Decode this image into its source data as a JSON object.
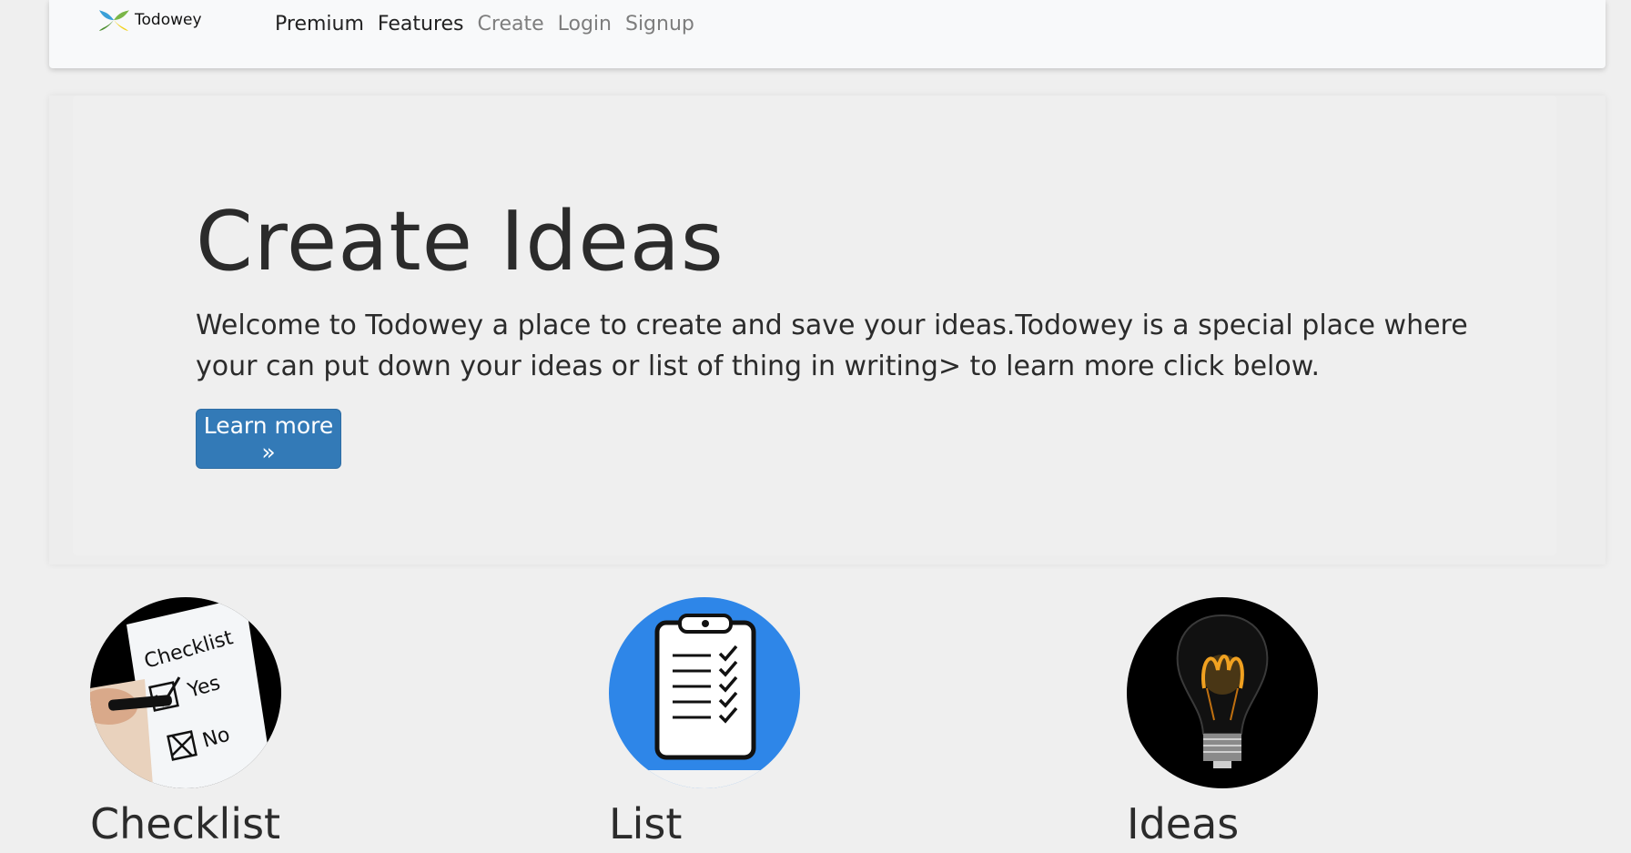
{
  "nav": {
    "brand": "Todowey",
    "links": [
      {
        "label": "Premium",
        "style": "dark"
      },
      {
        "label": "Features",
        "style": "dark"
      },
      {
        "label": "Create",
        "style": "muted"
      },
      {
        "label": "Login",
        "style": "muted"
      },
      {
        "label": "Signup",
        "style": "muted"
      }
    ]
  },
  "hero": {
    "title": "Create Ideas",
    "text": "Welcome to Todowey a place to create and save your ideas.Todowey is a special place where your can put down your ideas or list of thing in writing> to learn more click below.",
    "button_label": "Learn more »"
  },
  "features": [
    {
      "title": "Checklist",
      "image": "checklist-photo"
    },
    {
      "title": "List",
      "image": "clipboard-checklist-icon"
    },
    {
      "title": "Ideas",
      "image": "lightbulb-photo"
    }
  ],
  "colors": {
    "primary_button": "#337ab7",
    "list_icon_bg": "#2e86e8",
    "background": "#efefef"
  }
}
